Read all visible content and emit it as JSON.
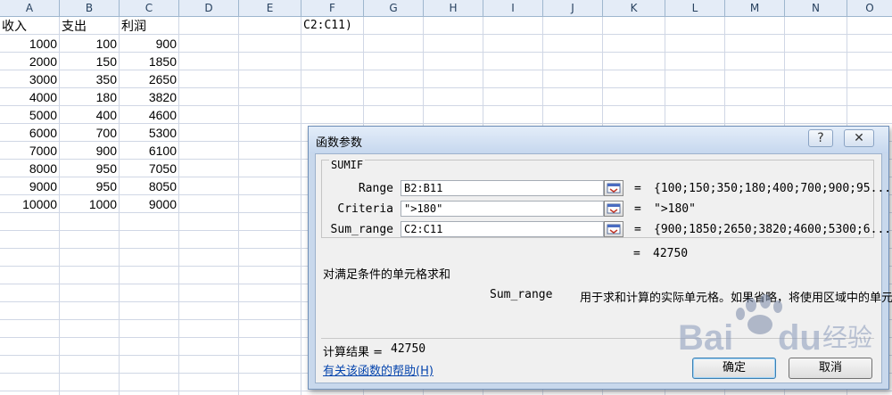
{
  "columns": [
    "A",
    "B",
    "C",
    "D",
    "E",
    "F",
    "G",
    "H",
    "I",
    "J",
    "K",
    "L",
    "M",
    "N",
    "O"
  ],
  "headers": {
    "a": "收入",
    "b": "支出",
    "c": "利润"
  },
  "rows": [
    [
      "1000",
      "100",
      "900"
    ],
    [
      "2000",
      "150",
      "1850"
    ],
    [
      "3000",
      "350",
      "2650"
    ],
    [
      "4000",
      "180",
      "3820"
    ],
    [
      "5000",
      "400",
      "4600"
    ],
    [
      "6000",
      "700",
      "5300"
    ],
    [
      "7000",
      "900",
      "6100"
    ],
    [
      "8000",
      "950",
      "7050"
    ],
    [
      "9000",
      "950",
      "8050"
    ],
    [
      "10000",
      "1000",
      "9000"
    ]
  ],
  "formula_fragment": "C2:C11)",
  "dialog": {
    "title": "函数参数",
    "help_btn": "?",
    "close_btn": "✕",
    "function_name": "SUMIF",
    "args": [
      {
        "label": "Range",
        "value": "B2:B11",
        "result": "{100;150;350;180;400;700;900;95..."
      },
      {
        "label": "Criteria",
        "value": "\">180\"",
        "result": "\">180\""
      },
      {
        "label": "Sum_range",
        "value": "C2:C11",
        "result": "{900;1850;2650;3820;4600;5300;6..."
      }
    ],
    "eq": "=",
    "total_result": "42750",
    "description": "对满足条件的单元格求和",
    "arg_help_name": "Sum_range",
    "arg_help_text": "用于求和计算的实际单元格。如果省略，将使用区域中的单元格",
    "calc_label": "计算结果 =",
    "calc_value": "42750",
    "help_link": "有关该函数的帮助(H)",
    "ok": "确定",
    "cancel": "取消"
  },
  "watermark": {
    "brand": "Bai",
    "brand2": "du",
    "suffix": "经验"
  }
}
